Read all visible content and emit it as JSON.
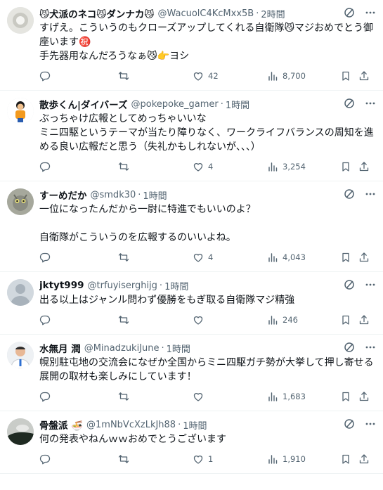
{
  "tweets": [
    {
      "name": "😼犬派のネコ😼ダンナカ😼",
      "handle": "@WacuolC4KcMxx5B",
      "time": "2時間",
      "text": "すげえ。こういうのもクローズアップしてくれる自衛隊😼マジおめでとう御座います㊗️\n手先器用なんだろうなぁ😼👉ヨシ",
      "replies": "",
      "retweets": "",
      "likes": "42",
      "views": "8,700"
    },
    {
      "name": "散歩くん|ダイバーズ",
      "handle": "@pokepoke_gamer",
      "time": "1時間",
      "text": "ぶっちゃけ広報としてめっちゃいいな\nミニ四駆というテーマが当たり障りなく、ワークライフバランスの周知を進める良い広報だと思う（失礼かもしれないが、、、）",
      "replies": "",
      "retweets": "",
      "likes": "4",
      "views": "3,254"
    },
    {
      "name": "すーめだか",
      "handle": "@smdk30",
      "time": "1時間",
      "text": "一位になったんだから一尉に特進でもいいのよ？\n\n自衛隊がこういうのを広報するのいいよね。",
      "replies": "",
      "retweets": "",
      "likes": "4",
      "views": "4,043"
    },
    {
      "name": "jktyt999",
      "handle": "@trfuyiserghijg",
      "time": "1時間",
      "text": "出る以上はジャンル問わず優勝をもぎ取る自衛隊マジ精強",
      "replies": "",
      "retweets": "",
      "likes": "",
      "views": "246"
    },
    {
      "name": "水無月 潤",
      "handle": "@MinadzukiJune",
      "time": "1時間",
      "text": "幌別駐屯地の交流会になぜか全国からミニ四駆ガチ勢が大挙して押し寄せる展開の取材も楽しみにしています！",
      "replies": "",
      "retweets": "",
      "likes": "",
      "views": "1,683"
    },
    {
      "name": "骨盤派 🍜",
      "handle": "@1mNbVcXzLkJh88",
      "time": "1時間",
      "text": "何の発表やねんｗｗおめでとうございます",
      "replies": "",
      "retweets": "",
      "likes": "1",
      "views": "1,910"
    }
  ],
  "colors": {
    "text": "#0f1419",
    "secondary": "#536471",
    "divider": "#eff3f4"
  },
  "icons": [
    "grok-icon",
    "more-icon",
    "reply-icon",
    "retweet-icon",
    "like-icon",
    "views-icon",
    "bookmark-icon",
    "share-icon"
  ]
}
